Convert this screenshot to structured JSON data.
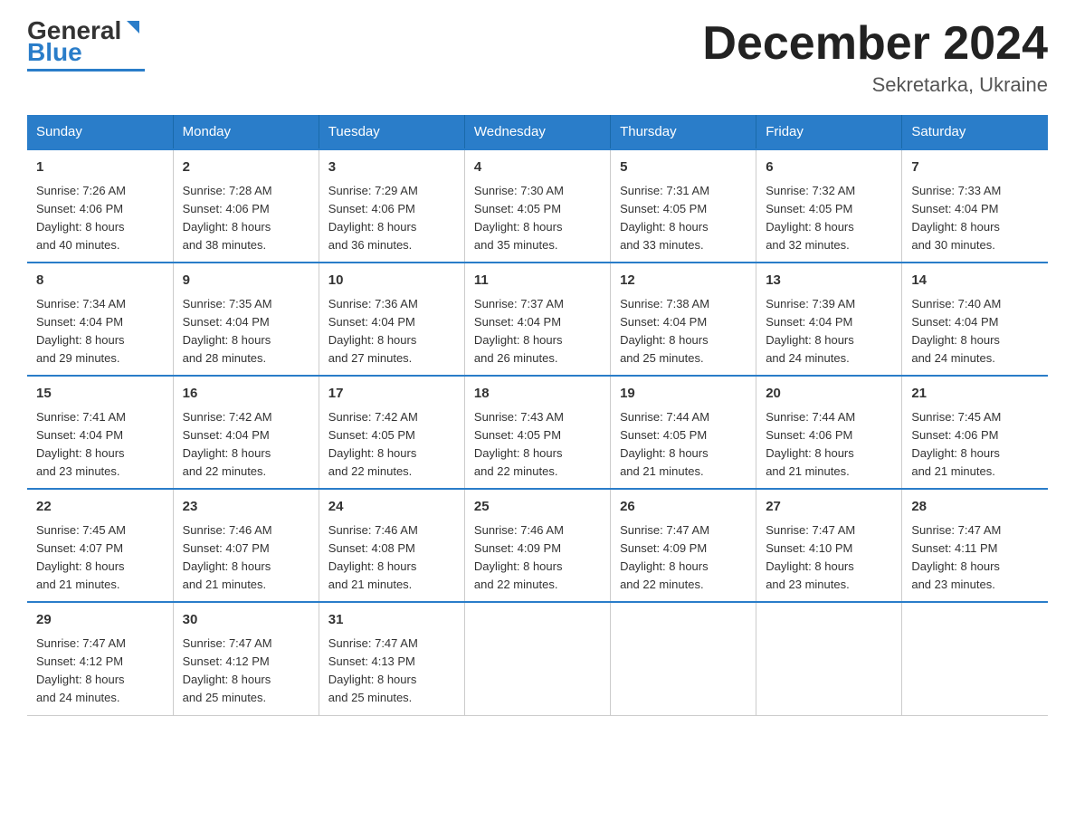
{
  "logo": {
    "general": "General",
    "blue": "Blue",
    "triangle": "▶"
  },
  "title": "December 2024",
  "subtitle": "Sekretarka, Ukraine",
  "days_of_week": [
    "Sunday",
    "Monday",
    "Tuesday",
    "Wednesday",
    "Thursday",
    "Friday",
    "Saturday"
  ],
  "weeks": [
    [
      {
        "day": "1",
        "sunrise": "7:26 AM",
        "sunset": "4:06 PM",
        "daylight": "8 hours and 40 minutes."
      },
      {
        "day": "2",
        "sunrise": "7:28 AM",
        "sunset": "4:06 PM",
        "daylight": "8 hours and 38 minutes."
      },
      {
        "day": "3",
        "sunrise": "7:29 AM",
        "sunset": "4:06 PM",
        "daylight": "8 hours and 36 minutes."
      },
      {
        "day": "4",
        "sunrise": "7:30 AM",
        "sunset": "4:05 PM",
        "daylight": "8 hours and 35 minutes."
      },
      {
        "day": "5",
        "sunrise": "7:31 AM",
        "sunset": "4:05 PM",
        "daylight": "8 hours and 33 minutes."
      },
      {
        "day": "6",
        "sunrise": "7:32 AM",
        "sunset": "4:05 PM",
        "daylight": "8 hours and 32 minutes."
      },
      {
        "day": "7",
        "sunrise": "7:33 AM",
        "sunset": "4:04 PM",
        "daylight": "8 hours and 30 minutes."
      }
    ],
    [
      {
        "day": "8",
        "sunrise": "7:34 AM",
        "sunset": "4:04 PM",
        "daylight": "8 hours and 29 minutes."
      },
      {
        "day": "9",
        "sunrise": "7:35 AM",
        "sunset": "4:04 PM",
        "daylight": "8 hours and 28 minutes."
      },
      {
        "day": "10",
        "sunrise": "7:36 AM",
        "sunset": "4:04 PM",
        "daylight": "8 hours and 27 minutes."
      },
      {
        "day": "11",
        "sunrise": "7:37 AM",
        "sunset": "4:04 PM",
        "daylight": "8 hours and 26 minutes."
      },
      {
        "day": "12",
        "sunrise": "7:38 AM",
        "sunset": "4:04 PM",
        "daylight": "8 hours and 25 minutes."
      },
      {
        "day": "13",
        "sunrise": "7:39 AM",
        "sunset": "4:04 PM",
        "daylight": "8 hours and 24 minutes."
      },
      {
        "day": "14",
        "sunrise": "7:40 AM",
        "sunset": "4:04 PM",
        "daylight": "8 hours and 24 minutes."
      }
    ],
    [
      {
        "day": "15",
        "sunrise": "7:41 AM",
        "sunset": "4:04 PM",
        "daylight": "8 hours and 23 minutes."
      },
      {
        "day": "16",
        "sunrise": "7:42 AM",
        "sunset": "4:04 PM",
        "daylight": "8 hours and 22 minutes."
      },
      {
        "day": "17",
        "sunrise": "7:42 AM",
        "sunset": "4:05 PM",
        "daylight": "8 hours and 22 minutes."
      },
      {
        "day": "18",
        "sunrise": "7:43 AM",
        "sunset": "4:05 PM",
        "daylight": "8 hours and 22 minutes."
      },
      {
        "day": "19",
        "sunrise": "7:44 AM",
        "sunset": "4:05 PM",
        "daylight": "8 hours and 21 minutes."
      },
      {
        "day": "20",
        "sunrise": "7:44 AM",
        "sunset": "4:06 PM",
        "daylight": "8 hours and 21 minutes."
      },
      {
        "day": "21",
        "sunrise": "7:45 AM",
        "sunset": "4:06 PM",
        "daylight": "8 hours and 21 minutes."
      }
    ],
    [
      {
        "day": "22",
        "sunrise": "7:45 AM",
        "sunset": "4:07 PM",
        "daylight": "8 hours and 21 minutes."
      },
      {
        "day": "23",
        "sunrise": "7:46 AM",
        "sunset": "4:07 PM",
        "daylight": "8 hours and 21 minutes."
      },
      {
        "day": "24",
        "sunrise": "7:46 AM",
        "sunset": "4:08 PM",
        "daylight": "8 hours and 21 minutes."
      },
      {
        "day": "25",
        "sunrise": "7:46 AM",
        "sunset": "4:09 PM",
        "daylight": "8 hours and 22 minutes."
      },
      {
        "day": "26",
        "sunrise": "7:47 AM",
        "sunset": "4:09 PM",
        "daylight": "8 hours and 22 minutes."
      },
      {
        "day": "27",
        "sunrise": "7:47 AM",
        "sunset": "4:10 PM",
        "daylight": "8 hours and 23 minutes."
      },
      {
        "day": "28",
        "sunrise": "7:47 AM",
        "sunset": "4:11 PM",
        "daylight": "8 hours and 23 minutes."
      }
    ],
    [
      {
        "day": "29",
        "sunrise": "7:47 AM",
        "sunset": "4:12 PM",
        "daylight": "8 hours and 24 minutes."
      },
      {
        "day": "30",
        "sunrise": "7:47 AM",
        "sunset": "4:12 PM",
        "daylight": "8 hours and 25 minutes."
      },
      {
        "day": "31",
        "sunrise": "7:47 AM",
        "sunset": "4:13 PM",
        "daylight": "8 hours and 25 minutes."
      },
      null,
      null,
      null,
      null
    ]
  ],
  "labels": {
    "sunrise": "Sunrise:",
    "sunset": "Sunset:",
    "daylight": "Daylight:"
  }
}
